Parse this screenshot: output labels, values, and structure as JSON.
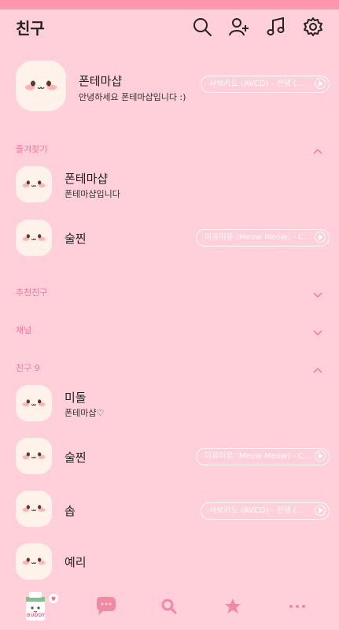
{
  "header": {
    "title": "친구"
  },
  "profile": {
    "name": "폰테마샵",
    "status": "안녕하세요 폰테마샵입니다 :)",
    "music": "사보카도 (AVCD) - 펀댕 (..."
  },
  "sections": {
    "favorites": "즐겨찾기",
    "recommended": "추천친구",
    "channel": "채널",
    "friends": "친구 9"
  },
  "favorites": [
    {
      "name": "폰테마샵",
      "status": "폰테마샵입니다"
    },
    {
      "name": "술찐",
      "music": "미유미유 (Meow Meow) - C..."
    }
  ],
  "friends": [
    {
      "name": "미돌",
      "status": "폰테마샵♡"
    },
    {
      "name": "술찐",
      "music": "미유미유 (Meow Meow) - C..."
    },
    {
      "name": "솝",
      "music": "사보카도 (AVCD) - 펀댕 (..."
    },
    {
      "name": "예리"
    }
  ],
  "tabbar": {
    "badge_label": "BUDDY"
  },
  "colors": {
    "background": "#ffd0da",
    "accent": "#f07a9a",
    "top_strip": "#ff96ad"
  }
}
